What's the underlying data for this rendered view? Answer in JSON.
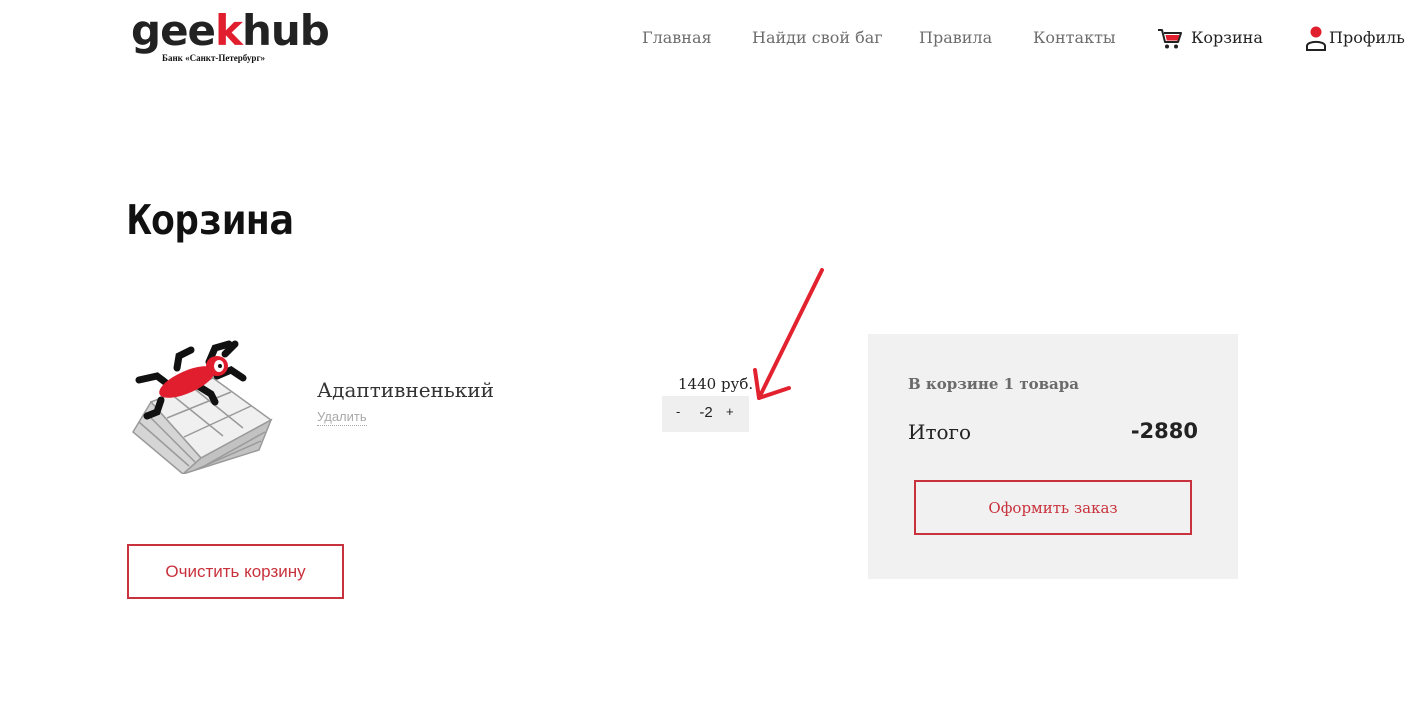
{
  "header": {
    "logo": {
      "word_start": "gee",
      "word_accent": "k",
      "word_end": "hub",
      "subtitle": "Банк «Санкт-Петербург»"
    },
    "nav": {
      "home": "Главная",
      "find_bug": "Найди свой баг",
      "rules": "Правила",
      "contacts": "Контакты",
      "cart": "Корзина",
      "profile": "Профиль"
    }
  },
  "page": {
    "title": "Корзина"
  },
  "cart_item": {
    "name": "Адаптивненький",
    "remove_label": "Удалить",
    "price": "1440 руб.",
    "qty_minus": "-",
    "qty_value": "-2",
    "qty_plus": "+"
  },
  "actions": {
    "clear_cart": "Очистить корзину"
  },
  "summary": {
    "count_text": "В корзине 1 товара",
    "total_label": "Итого",
    "total_value": "-2880",
    "checkout_label": "Оформить заказ"
  },
  "colors": {
    "accent": "#e01e2e",
    "button_border": "#c8323d",
    "summary_bg": "#f1f1f1",
    "qty_bg": "#efefef",
    "annotation_arrow": "#e2232f"
  },
  "icons": [
    "cart-icon",
    "user-icon",
    "annotation-arrow-icon"
  ]
}
